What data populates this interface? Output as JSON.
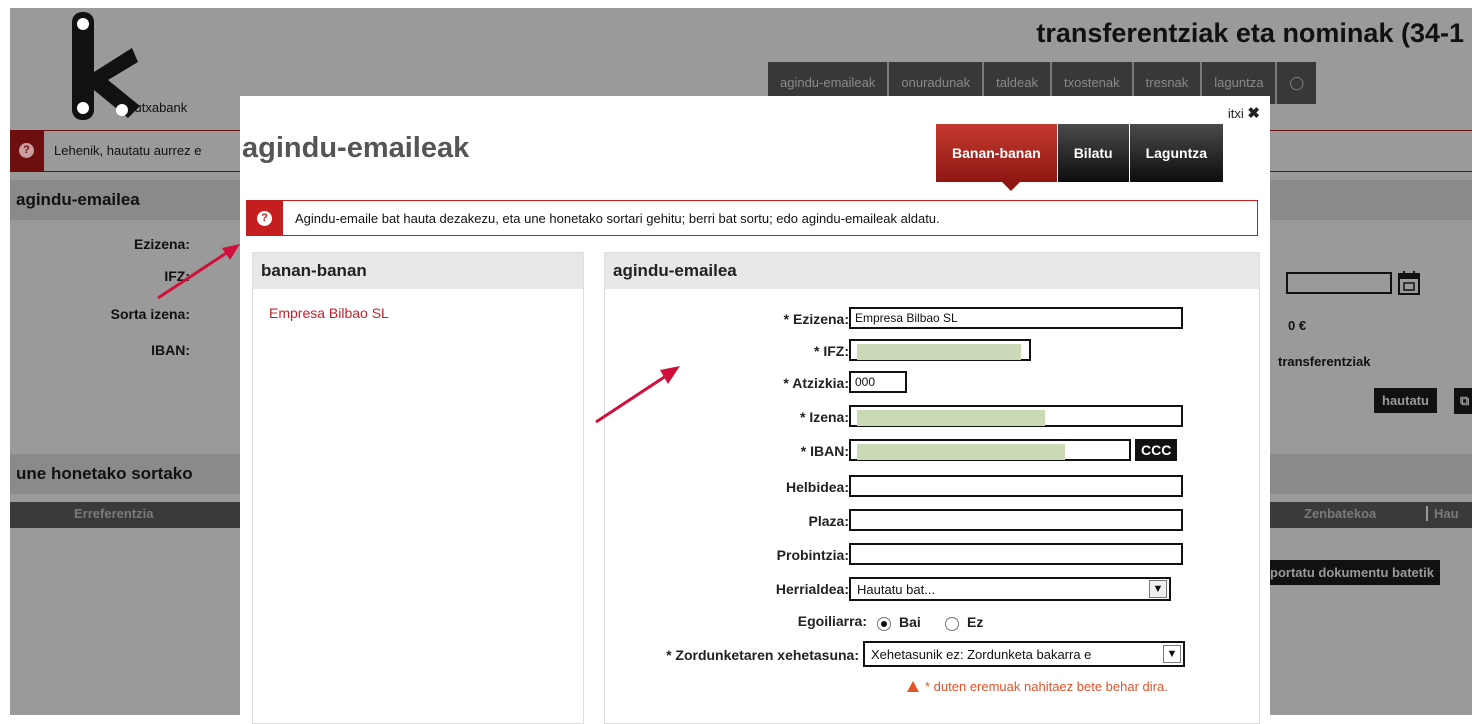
{
  "background": {
    "app_title": "transferentziak eta nominak (34-1",
    "logo_text": "kutxabank",
    "nav": [
      "agindu-emaileak",
      "onuradunak",
      "taldeak",
      "txostenak",
      "tresnak",
      "laguntza"
    ],
    "notice": "Lehenik, hautatu aurrez e",
    "section1_title": "agindu-emailea",
    "labels": {
      "ezizena": "Ezizena:",
      "ifz": "IFZ:",
      "sorta_izena": "Sorta izena:",
      "iban": "IBAN:"
    },
    "amount": "0 €",
    "transfer_label": "transferentziak",
    "hautatu_button": "hautatu",
    "section2_title": "une honetako sortako",
    "table_headers": {
      "ref": "Erreferentzia",
      "zenbatekoa": "Zenbatekoa",
      "hau": "Hau"
    },
    "import_button": "portatu dokumentu batetik"
  },
  "modal": {
    "title": "agindu-emaileak",
    "close_label": "itxi",
    "tabs": [
      {
        "label": "Banan-banan",
        "active": true
      },
      {
        "label": "Bilatu",
        "active": false
      },
      {
        "label": "Laguntza",
        "active": false
      }
    ],
    "info_text": "Agindu-emaile bat hauta dezakezu, eta une honetako sortari gehitu; berri bat sortu; edo agindu-emaileak aldatu.",
    "left_panel": {
      "title": "banan-banan",
      "items": [
        "Empresa Bilbao SL"
      ]
    },
    "form": {
      "title": "agindu-emailea",
      "fields": {
        "ezizena": {
          "label": "* Ezizena:",
          "value": "Empresa Bilbao SL"
        },
        "ifz": {
          "label": "* IFZ:",
          "value": ""
        },
        "atzizkia": {
          "label": "* Atzizkia:",
          "value": "000"
        },
        "izena": {
          "label": "* Izena:",
          "value": ""
        },
        "iban": {
          "label": "* IBAN:",
          "value": ""
        },
        "helbidea": {
          "label": "Helbidea:",
          "value": ""
        },
        "plaza": {
          "label": "Plaza:",
          "value": ""
        },
        "probintzia": {
          "label": "Probintzia:",
          "value": ""
        },
        "herrialdea": {
          "label": "Herrialdea:",
          "value": "Hautatu bat..."
        },
        "zordunketa": {
          "label": "* Zordunketaren xehetasuna:",
          "value": "Xehetasunik ez: Zordunketa bakarra e"
        }
      },
      "ccc_button": "CCC",
      "egoiliarra": {
        "label": "Egoiliarra:",
        "options": [
          "Bai",
          "Ez"
        ],
        "selected": "Bai"
      },
      "required_note": "* duten eremuak nahitaez bete behar dira."
    }
  },
  "colors": {
    "accent_red": "#c41e1e",
    "redacted_green": "#cad9b6",
    "annotation_arrow": "#d0103a"
  }
}
